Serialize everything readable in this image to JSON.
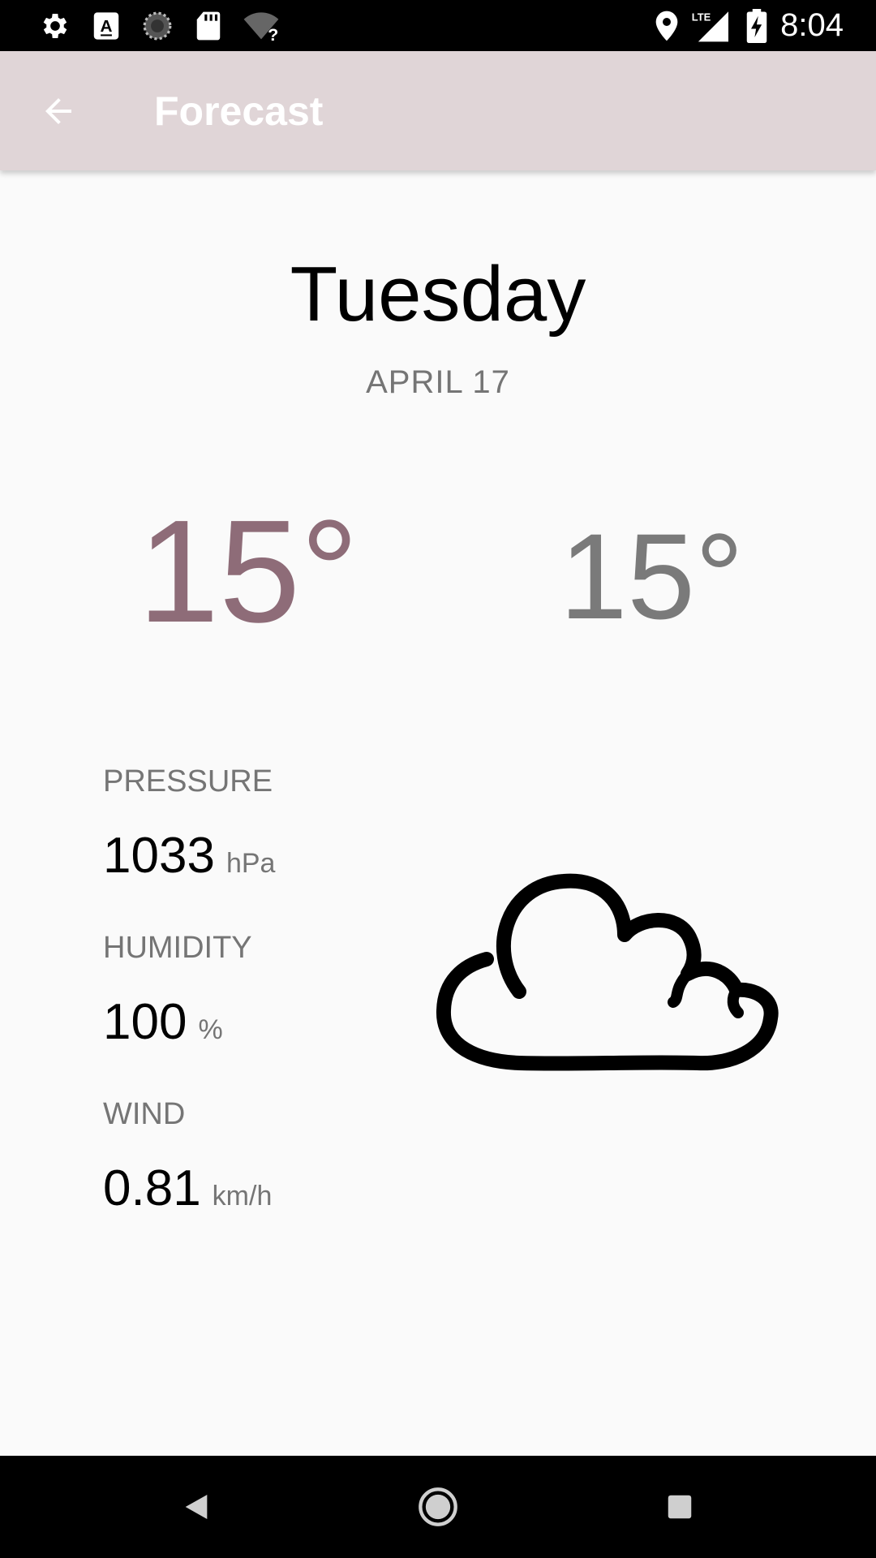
{
  "status_bar": {
    "time": "8:04",
    "left_icons": [
      "settings-icon",
      "font-icon",
      "sync-icon",
      "sd-card-icon",
      "wifi-unknown-icon"
    ],
    "right_icons": [
      "location-icon",
      "lte-signal-icon",
      "battery-charging-icon"
    ],
    "network_label": "LTE"
  },
  "app_bar": {
    "title": "Forecast",
    "back_icon": "arrow-back-icon",
    "background": "#e0d5d7"
  },
  "forecast": {
    "day": "Tuesday",
    "date": "APRIL 17",
    "high": "15°",
    "low": "15°",
    "high_color": "#8e6c78",
    "low_color": "#7a7a7a",
    "condition_icon": "cloud-icon"
  },
  "details": {
    "pressure": {
      "label": "PRESSURE",
      "value": "1033",
      "unit": "hPa"
    },
    "humidity": {
      "label": "HUMIDITY",
      "value": "100",
      "unit": "%"
    },
    "wind": {
      "label": "WIND",
      "value": "0.81",
      "unit": "km/h"
    }
  },
  "nav_bar": {
    "buttons": [
      "back-nav-icon",
      "home-nav-icon",
      "recents-nav-icon"
    ]
  }
}
